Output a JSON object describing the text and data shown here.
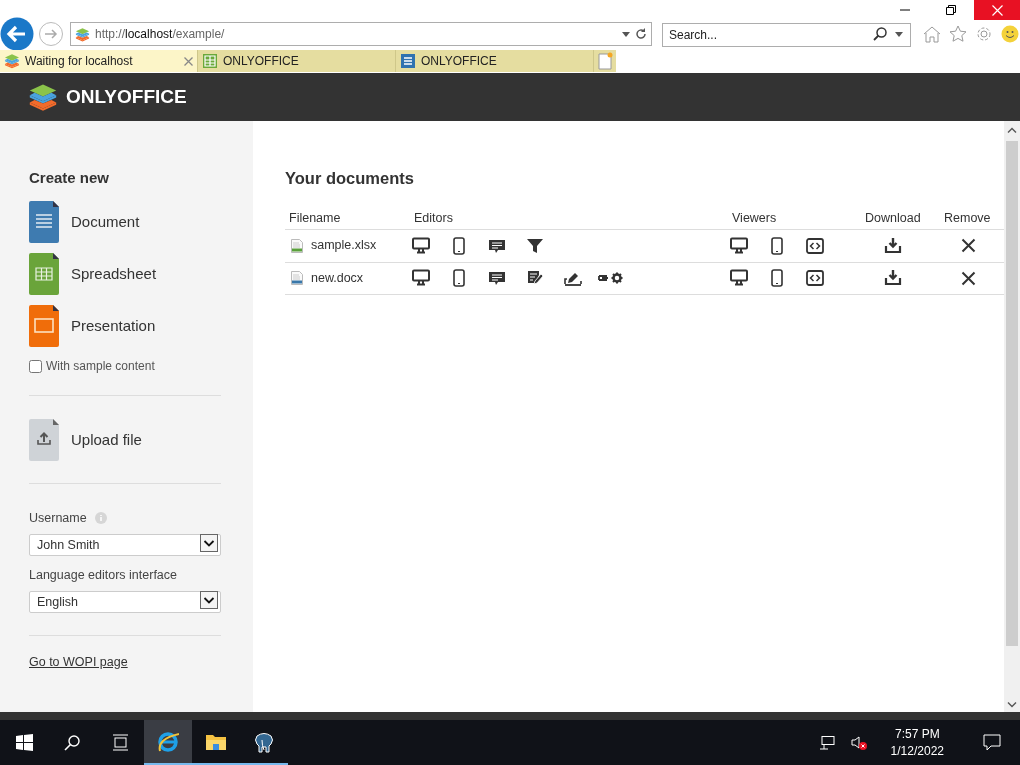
{
  "browser": {
    "address": {
      "scheme": "http://",
      "host": "localhost",
      "path": "/example/"
    },
    "search_placeholder": "Search...",
    "tabs": [
      {
        "label": "Waiting for localhost",
        "kind": "logo",
        "selected": true
      },
      {
        "label": "ONLYOFFICE",
        "kind": "spreadsheet",
        "selected": false
      },
      {
        "label": "ONLYOFFICE",
        "kind": "document",
        "selected": false
      }
    ]
  },
  "header": {
    "logo_text": "ONLYOFFICE"
  },
  "sidebar": {
    "title": "Create new",
    "create_items": [
      {
        "label": "Document",
        "kind": "document"
      },
      {
        "label": "Spreadsheet",
        "kind": "spreadsheet"
      },
      {
        "label": "Presentation",
        "kind": "presentation"
      }
    ],
    "sample_content": {
      "label": "With sample content",
      "checked": false
    },
    "upload": {
      "label": "Upload file"
    },
    "username": {
      "label": "Username",
      "value": "John Smith"
    },
    "language": {
      "label": "Language editors interface",
      "value": "English"
    },
    "wopi_link": "Go to WOPI page"
  },
  "documents": {
    "title": "Your documents",
    "columns": [
      "Filename",
      "Editors",
      "Viewers",
      "Download",
      "Remove"
    ],
    "rows": [
      {
        "filename": "sample.xlsx",
        "kind": "spreadsheet",
        "editors": [
          {
            "kind": "desktop"
          },
          {
            "kind": "mobile"
          },
          {
            "kind": "comment"
          },
          {
            "kind": "filter"
          }
        ],
        "viewers": [
          {
            "kind": "desktop"
          },
          {
            "kind": "mobile"
          },
          {
            "kind": "embedded"
          }
        ]
      },
      {
        "filename": "new.docx",
        "kind": "document",
        "editors": [
          {
            "kind": "desktop"
          },
          {
            "kind": "mobile"
          },
          {
            "kind": "comment"
          },
          {
            "kind": "review"
          },
          {
            "kind": "fill"
          },
          {
            "kind": "embed-settings"
          }
        ],
        "viewers": [
          {
            "kind": "desktop"
          },
          {
            "kind": "mobile"
          },
          {
            "kind": "embedded"
          }
        ]
      }
    ]
  },
  "taskbar": {
    "apps": [
      {
        "kind": "browser",
        "selected": true
      },
      {
        "kind": "folder",
        "selected": false
      },
      {
        "kind": "elephant",
        "selected": false
      }
    ],
    "time": "7:57 PM",
    "date": "1/12/2022"
  }
}
